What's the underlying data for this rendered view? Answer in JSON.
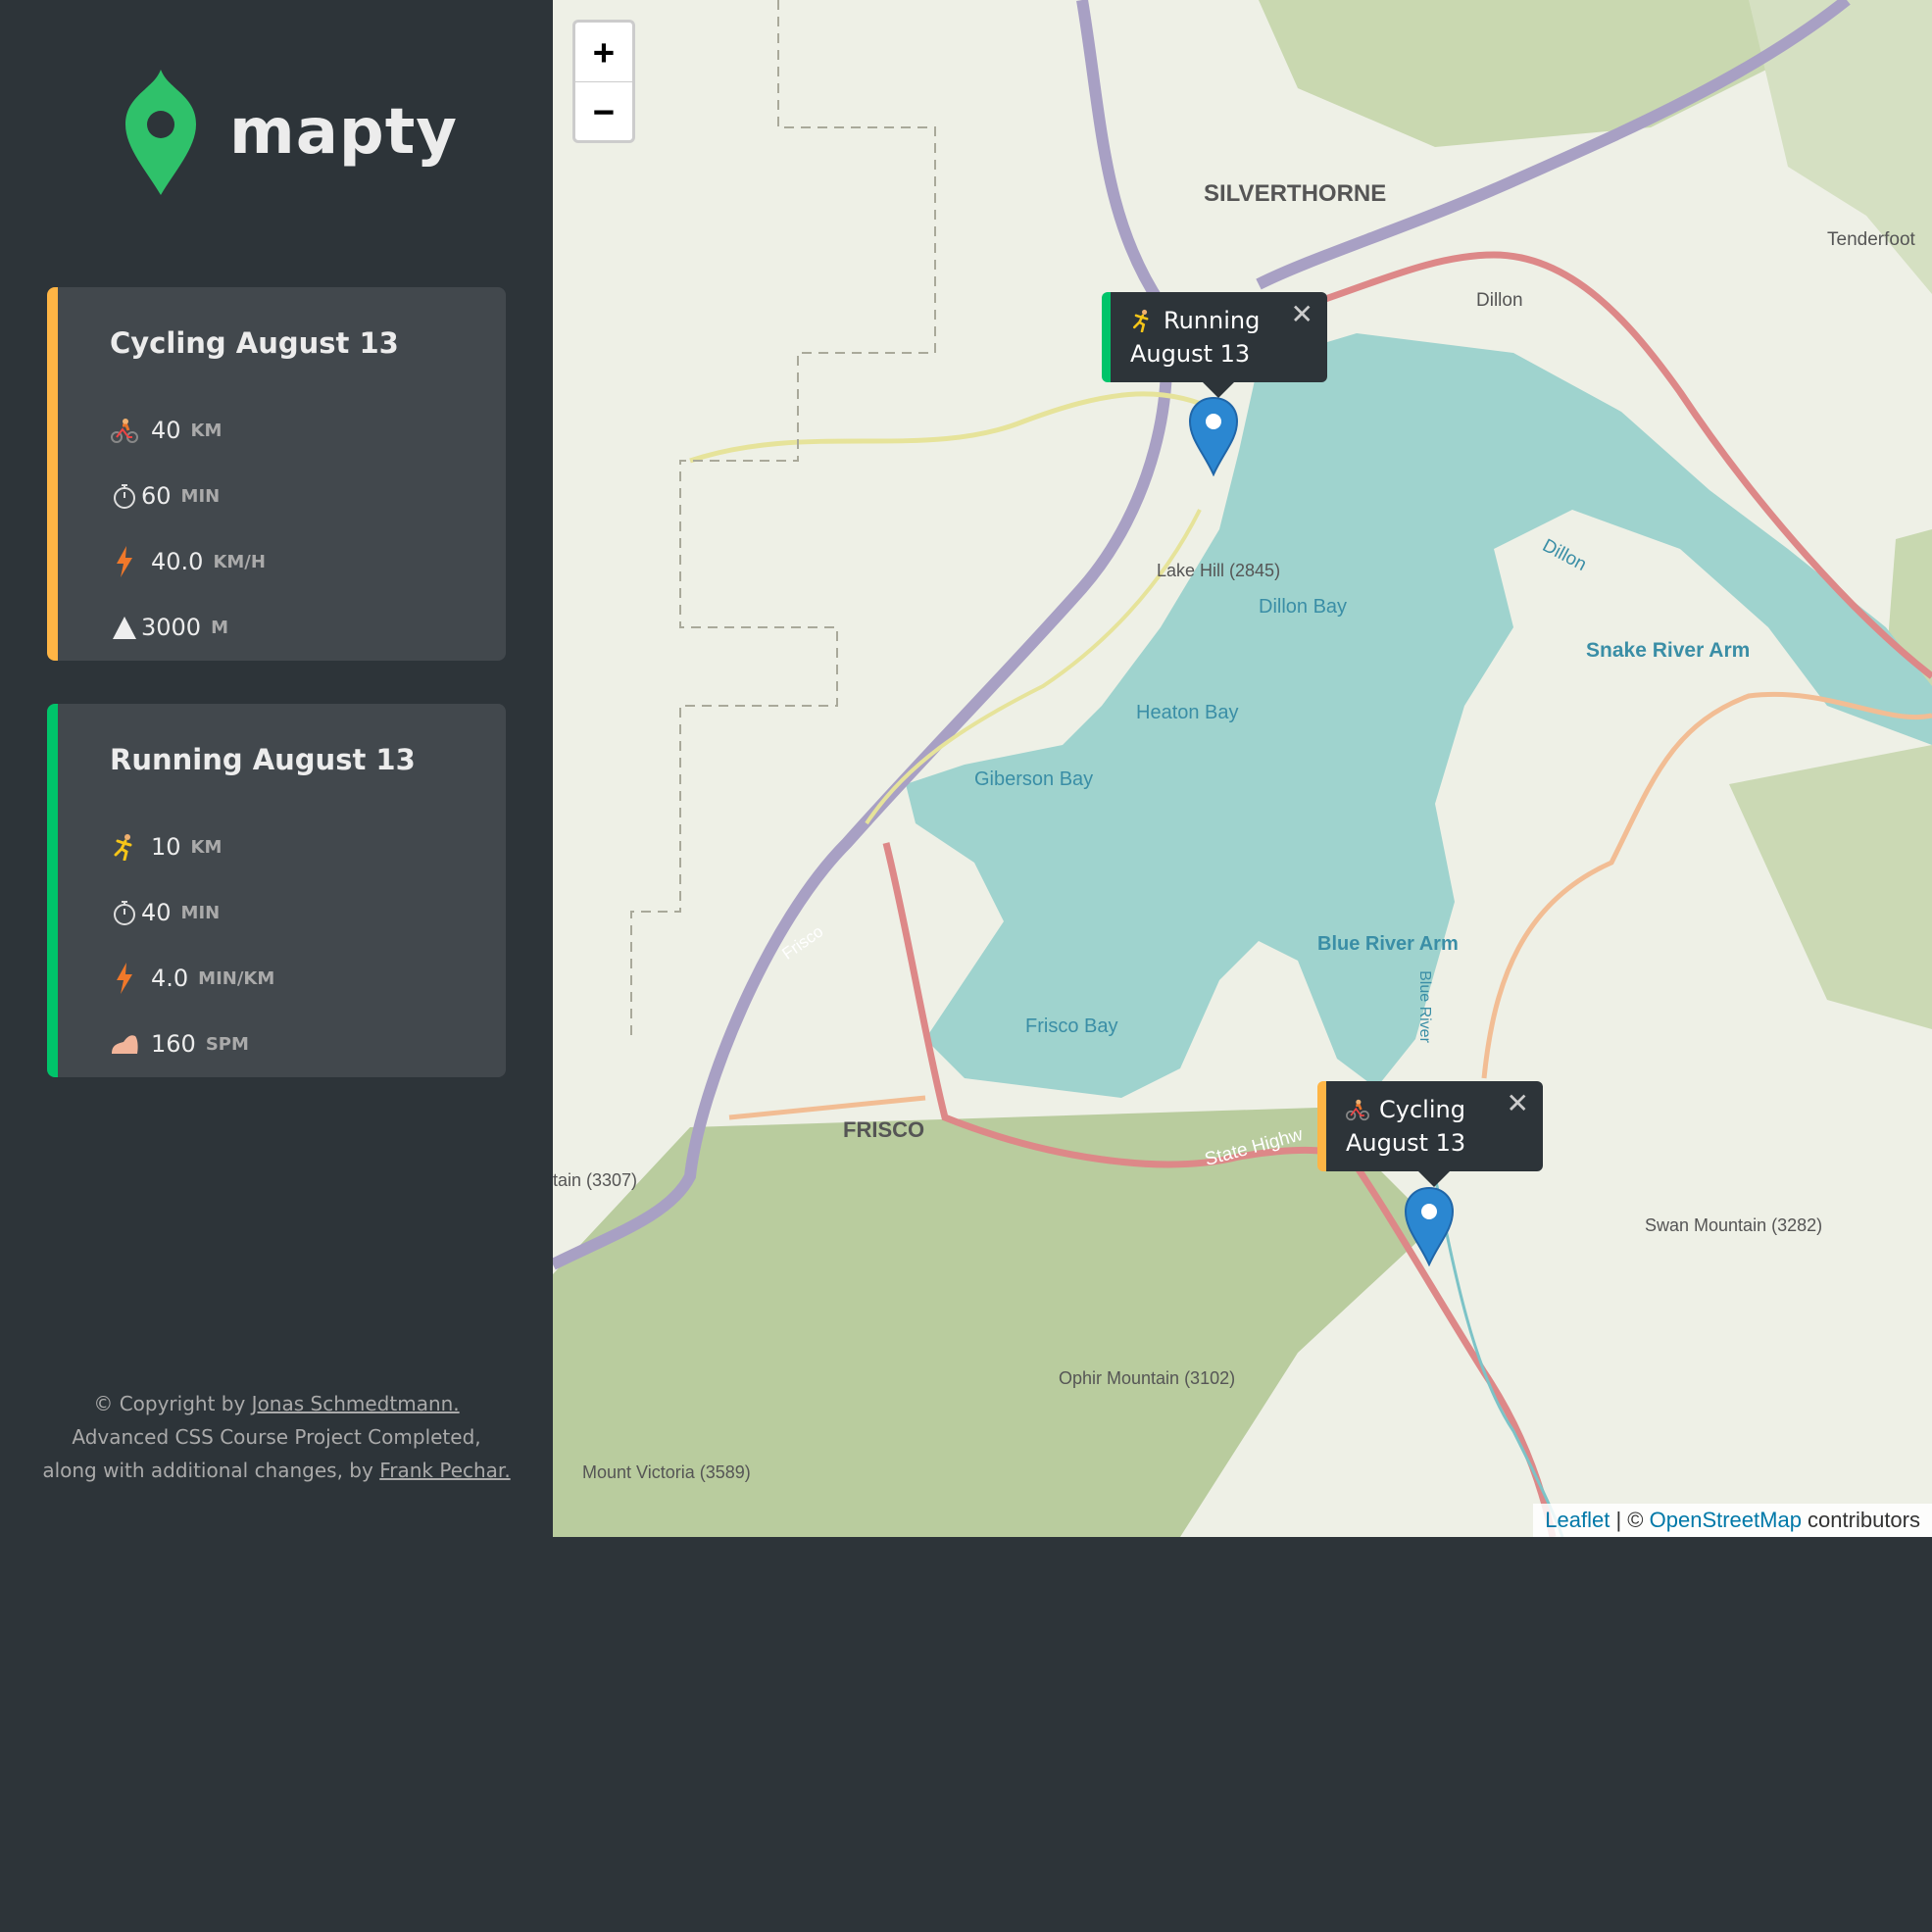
{
  "app": {
    "name": "mapty",
    "brand_color": "#00c46a",
    "cycling_color": "#ffb545",
    "running_color": "#00c46a"
  },
  "workouts": [
    {
      "type": "cycling",
      "title": "Cycling August 13",
      "stats": [
        {
          "icon": "cycling-icon",
          "value": "40",
          "unit": "KM"
        },
        {
          "icon": "stopwatch-icon",
          "value": "60",
          "unit": "MIN"
        },
        {
          "icon": "lightning-icon",
          "value": "40.0",
          "unit": "KM/H"
        },
        {
          "icon": "mountain-icon",
          "value": "3000",
          "unit": "M"
        }
      ]
    },
    {
      "type": "running",
      "title": "Running August 13",
      "stats": [
        {
          "icon": "running-icon",
          "value": "10",
          "unit": "KM"
        },
        {
          "icon": "stopwatch-icon",
          "value": "40",
          "unit": "MIN"
        },
        {
          "icon": "lightning-icon",
          "value": "4.0",
          "unit": "MIN/KM"
        },
        {
          "icon": "foot-icon",
          "value": "160",
          "unit": "SPM"
        }
      ]
    }
  ],
  "footer": {
    "line1_prefix": "© Copyright by ",
    "line1_link": "Jonas Schmedtmann.",
    "line2": "Advanced CSS Course Project Completed,",
    "line3_prefix": "along with additional changes, by ",
    "line3_link": "Frank Pechar."
  },
  "map": {
    "zoom_in": "+",
    "zoom_out": "−",
    "popups": [
      {
        "type": "running",
        "icon": "running-icon",
        "line1": "Running",
        "line2": "August 13",
        "close": "✕"
      },
      {
        "type": "cycling",
        "icon": "cycling-icon",
        "line1": "Cycling",
        "line2": "August 13",
        "close": "✕"
      }
    ],
    "labels": {
      "silverthorne": "SILVERTHORNE",
      "tenderfoot": "Tenderfoot",
      "dillon": "Dillon",
      "dillon_river": "Dillon",
      "lake_hill": "Lake Hill (2845)",
      "dillon_bay": "Dillon Bay",
      "snake_river": "Snake River Arm",
      "heaton_bay": "Heaton Bay",
      "giberson_bay": "Giberson Bay",
      "frisco_road": "Frisco",
      "blue_river_arm": "Blue River Arm",
      "blue_river": "Blue River",
      "frisco_bay": "Frisco Bay",
      "frisco": "FRISCO",
      "state_highway": "State Highw",
      "mountain_3307": "tain (3307)",
      "swan_mountain": "Swan Mountain (3282)",
      "ophir_mountain": "Ophir Mountain (3102)",
      "mount_victoria": "Mount Victoria (3589)"
    },
    "attribution": {
      "leaflet": "Leaflet",
      "separator": " | © ",
      "osm": "OpenStreetMap",
      "suffix": " contributors"
    }
  }
}
